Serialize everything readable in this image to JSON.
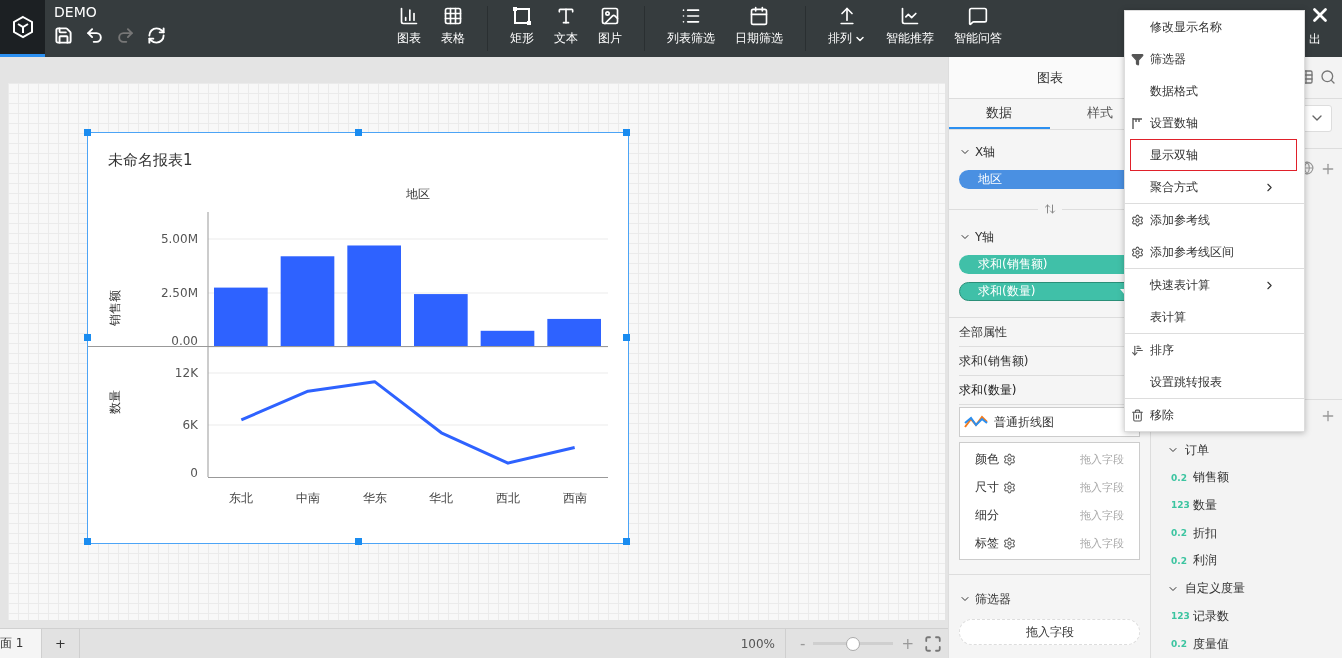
{
  "app": {
    "title": "DEMO"
  },
  "file_tools": [
    {
      "kind": "save",
      "disabled": false
    },
    {
      "kind": "undo",
      "disabled": false
    },
    {
      "kind": "redo",
      "disabled": true
    },
    {
      "kind": "refresh",
      "disabled": false
    }
  ],
  "toolbar": [
    [
      {
        "kind": "chart",
        "label": "图表"
      },
      {
        "kind": "table",
        "label": "表格"
      }
    ],
    [
      {
        "kind": "rectangle",
        "label": "矩形"
      },
      {
        "kind": "text",
        "label": "文本"
      },
      {
        "kind": "image",
        "label": "图片"
      }
    ],
    [
      {
        "kind": "list",
        "label": "列表筛选"
      },
      {
        "kind": "calendar",
        "label": "日期筛选"
      }
    ],
    [
      {
        "kind": "arrange",
        "label": "排列",
        "dropdown": true
      },
      {
        "kind": "trend",
        "label": "智能推荐",
        "dropdown": false
      },
      {
        "kind": "chat",
        "label": "智能问答",
        "dropdown": false
      }
    ]
  ],
  "exit": {
    "label": "出"
  },
  "report": {
    "title": "未命名报表1",
    "panels": [
      {
        "chart_data": {
          "type": "bar",
          "xlabel": "地区",
          "ylabel": "销售额",
          "series": [
            {
              "color": "#2e62ff",
              "values": [
                2750000,
                4200000,
                4700000,
                2450000,
                750000,
                1300000
              ]
            }
          ],
          "ylim": [
            0,
            6250000
          ],
          "yticks": [
            {
              "value": 0,
              "label": "0.00"
            },
            {
              "value": 2500000,
              "label": "2.50M"
            },
            {
              "value": 5000000,
              "label": "5.00M"
            }
          ]
        }
      },
      {
        "chart_data": {
          "type": "line",
          "ylabel": "数量",
          "categories": [
            "东北",
            "中南",
            "华东",
            "华北",
            "西北",
            "西南"
          ],
          "series": [
            {
              "color": "#2e62ff",
              "values": [
                6600,
                9900,
                11000,
                5100,
                1600,
                3400
              ]
            }
          ],
          "ylim": [
            0,
            15000
          ],
          "yticks": [
            {
              "value": 0,
              "label": "0"
            },
            {
              "value": 6000,
              "label": "6K"
            },
            {
              "value": 12000,
              "label": "12K"
            }
          ]
        }
      }
    ]
  },
  "page_tabs": [
    {
      "label": "面 1",
      "selected": true
    }
  ],
  "add_page": {
    "label": "+"
  },
  "zoom": {
    "reading": "100%",
    "minus": "-",
    "plus": "+",
    "level": 0.49
  },
  "chart_panel": {
    "title": "图表",
    "tabs": [
      {
        "label": "数据",
        "selected": true
      },
      {
        "label": "样式",
        "selected": false
      }
    ],
    "x_axis": {
      "label": "X轴",
      "expanded": true,
      "pills": [
        {
          "label": "地区",
          "kind": "dimension",
          "active": false
        }
      ]
    },
    "y_axis": {
      "label": "Y轴",
      "expanded": true,
      "pills": [
        {
          "label": "求和(销售额)",
          "kind": "measure",
          "active": false
        },
        {
          "label": "求和(数量)",
          "kind": "measure",
          "active": true
        }
      ]
    },
    "properties": [
      {
        "label": "全部属性",
        "selected": false
      },
      {
        "label": "求和(销售额)",
        "selected": false
      },
      {
        "label": "求和(数量)",
        "selected": true
      }
    ],
    "chart_type": {
      "label": "普通折线图"
    },
    "marks": [
      {
        "label": "颜色",
        "settings": true,
        "hint": "拖入字段"
      },
      {
        "label": "尺寸",
        "settings": true,
        "hint": "拖入字段"
      },
      {
        "label": "细分",
        "settings": false,
        "hint": "拖入字段"
      },
      {
        "label": "标签",
        "settings": true,
        "hint": "拖入字段"
      }
    ],
    "filter": {
      "label": "筛选器",
      "expanded": true,
      "dropzone": "拖入字段"
    }
  },
  "field_panel": {
    "groups": [
      {
        "label": "订单",
        "expanded": true,
        "children": [
          {
            "type": "0.2",
            "label": "销售额"
          },
          {
            "type": "123",
            "label": "数量"
          },
          {
            "type": "0.2",
            "label": "折扣"
          },
          {
            "type": "0.2",
            "label": "利润"
          }
        ]
      },
      {
        "label": "自定义度量",
        "expanded": true,
        "children": [
          {
            "type": "123",
            "label": "记录数"
          },
          {
            "type": "0.2",
            "label": "度量值"
          }
        ]
      }
    ]
  },
  "context_menu": {
    "groups": [
      [
        {
          "label": "修改显示名称",
          "kind": "plain",
          "submenu": false,
          "selected": false
        },
        {
          "label": "筛选器",
          "kind": "filter",
          "submenu": false,
          "selected": false
        },
        {
          "label": "数据格式",
          "kind": "plain",
          "submenu": false,
          "selected": false
        },
        {
          "label": "设置数轴",
          "kind": "axis",
          "submenu": false,
          "selected": false
        },
        {
          "label": "显示双轴",
          "kind": "plain",
          "submenu": false,
          "selected": true
        },
        {
          "label": "聚合方式",
          "kind": "plain",
          "submenu": true,
          "selected": false
        }
      ],
      [
        {
          "label": "添加参考线",
          "kind": "gear",
          "submenu": false,
          "selected": false
        },
        {
          "label": "添加参考线区间",
          "kind": "gear",
          "submenu": false,
          "selected": false
        }
      ],
      [
        {
          "label": "快速表计算",
          "kind": "plain",
          "submenu": true,
          "selected": false
        },
        {
          "label": "表计算",
          "kind": "plain",
          "submenu": false,
          "selected": false
        }
      ],
      [
        {
          "label": "排序",
          "kind": "sort",
          "submenu": false,
          "selected": false
        },
        {
          "label": "设置跳转报表",
          "kind": "plain",
          "submenu": false,
          "selected": false
        }
      ],
      [
        {
          "label": "移除",
          "kind": "trash",
          "submenu": false,
          "selected": false
        }
      ]
    ]
  }
}
